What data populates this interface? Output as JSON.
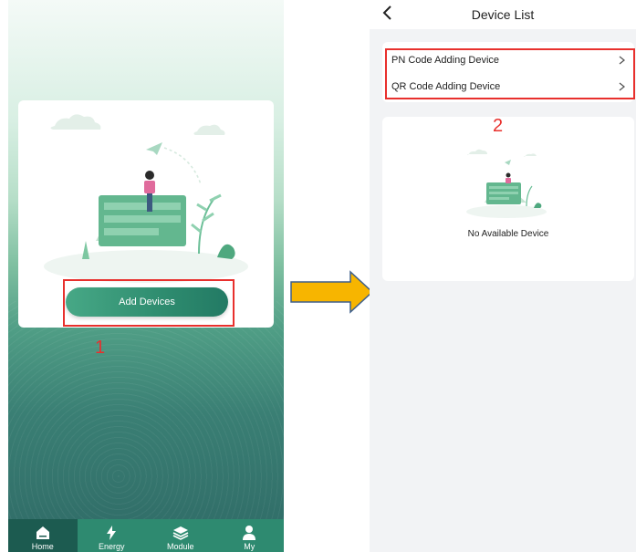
{
  "left_screen": {
    "add_button_label": "Add Devices",
    "step_label": "1",
    "tabs": [
      {
        "label": "Home",
        "icon": "home-icon",
        "active": true
      },
      {
        "label": "Energy",
        "icon": "lightning-icon",
        "active": false
      },
      {
        "label": "Module",
        "icon": "layers-icon",
        "active": false
      },
      {
        "label": "My",
        "icon": "user-icon",
        "active": false
      }
    ]
  },
  "right_screen": {
    "title": "Device List",
    "menu_items": [
      {
        "label": "PN Code Adding Device"
      },
      {
        "label": "QR Code Adding Device"
      }
    ],
    "step_label": "2",
    "empty_text": "No Available Device"
  },
  "colors": {
    "accent_green": "#2e8a70",
    "highlight_red": "#e8302d",
    "arrow_fill": "#f7b500"
  }
}
